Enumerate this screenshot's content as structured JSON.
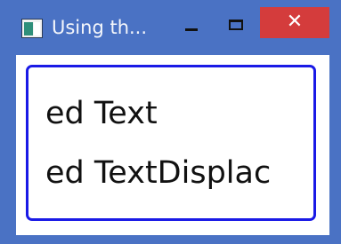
{
  "window": {
    "title": "Using th...",
    "controls": {
      "minimize_glyph": "minimize-icon",
      "maximize_glyph": "maximize-icon",
      "close_label": "✕"
    },
    "colors": {
      "frame": "#4a72c4",
      "close_button": "#d43c3c",
      "border": "#1a1ae6"
    }
  },
  "content": {
    "lines": [
      "ed Text",
      "ed TextDisplac"
    ]
  }
}
